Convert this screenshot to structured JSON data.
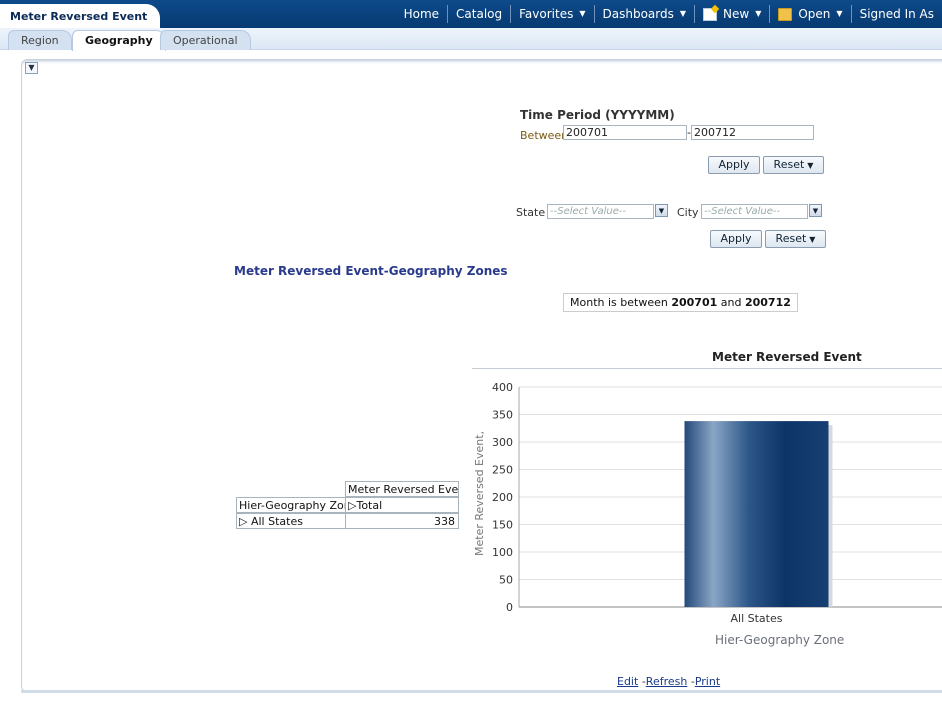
{
  "header": {
    "title": "Meter Reversed Event",
    "nav": [
      {
        "label": "Home",
        "caret": false,
        "icon": null
      },
      {
        "label": "Catalog",
        "caret": false,
        "icon": null
      },
      {
        "label": "Favorites",
        "caret": true,
        "icon": null
      },
      {
        "label": "Dashboards",
        "caret": true,
        "icon": null
      },
      {
        "label": "New",
        "caret": true,
        "icon": "new-document-icon"
      },
      {
        "label": "Open",
        "caret": true,
        "icon": "open-folder-icon"
      },
      {
        "label": "Signed In As",
        "caret": false,
        "icon": null
      }
    ]
  },
  "subtabs": [
    {
      "label": "Region",
      "active": false
    },
    {
      "label": "Geography",
      "active": true
    },
    {
      "label": "Operational",
      "active": false
    }
  ],
  "time_prompt": {
    "label": "Time Period (YYYYMM)",
    "between_label": "Between",
    "from_value": "200701",
    "separator": "-",
    "to_value": "200712",
    "apply": "Apply",
    "reset": "Reset"
  },
  "geo_prompt": {
    "state_label": "State",
    "state_placeholder": "--Select Value--",
    "city_label": "City",
    "city_placeholder": "--Select Value--",
    "apply": "Apply",
    "reset": "Reset"
  },
  "report": {
    "title": "Meter Reversed Event-Geography Zones",
    "filter_prefix": "Month is between",
    "filter_from": "200701",
    "filter_and": "and",
    "filter_to": "200712"
  },
  "pivot": {
    "measure_header": "Meter Reversed Event",
    "row_header": "Hier-Geography Zone",
    "column_member": "Total",
    "row_member": "All States",
    "value": "338"
  },
  "chart_data": {
    "type": "bar",
    "title": "Meter Reversed Event",
    "categories": [
      "All States"
    ],
    "values": [
      338
    ],
    "xlabel": "Hier-Geography Zone",
    "ylabel": "Meter Reversed Event,",
    "ylim": [
      0,
      400
    ],
    "yticks": [
      0,
      50,
      100,
      150,
      200,
      250,
      300,
      350,
      400
    ],
    "grid": true,
    "bar_color": "#1e4d82"
  },
  "footer": {
    "edit": "Edit",
    "refresh": "Refresh",
    "print": "Print",
    "sep": "-"
  }
}
